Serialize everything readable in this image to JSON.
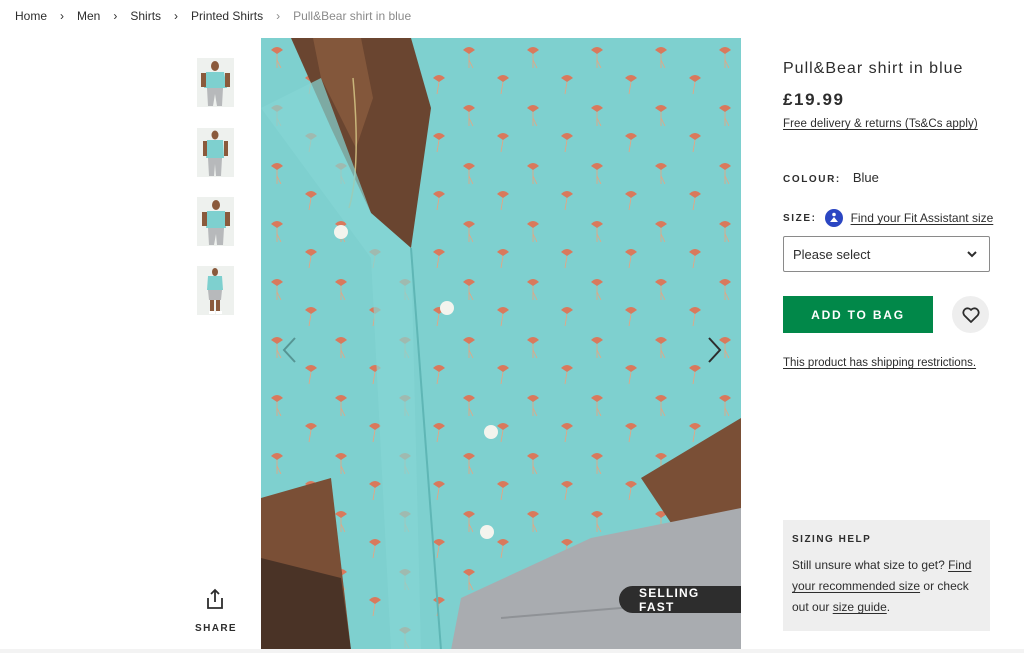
{
  "breadcrumb": {
    "items": [
      "Home",
      "Men",
      "Shirts",
      "Printed Shirts"
    ],
    "current": "Pull&Bear shirt in blue",
    "separator": "›"
  },
  "gallery": {
    "thumbnails": [
      "thumbnail-front",
      "thumbnail-side",
      "thumbnail-angle",
      "thumbnail-full"
    ],
    "badge": "SELLING FAST",
    "share_label": "SHARE",
    "icons": {
      "prev": "chevron-left-icon",
      "next": "chevron-right-icon",
      "share": "share-icon"
    }
  },
  "product": {
    "title": "Pull&Bear shirt in blue",
    "price": "£19.99",
    "delivery_link": "Free delivery & returns (Ts&Cs apply)",
    "colour_label": "COLOUR:",
    "colour_value": "Blue",
    "size_label": "SIZE:",
    "fit_link": "Find your Fit Assistant size",
    "size_placeholder": "Please select",
    "add_to_bag": "ADD TO BAG",
    "shipping_note": "This product has shipping restrictions."
  },
  "sizing_help": {
    "heading": "SIZING HELP",
    "text_1": "Still unsure what size to get? ",
    "link_1": "Find your recommended size",
    "text_2": " or check out our ",
    "link_2": "size guide",
    "text_3": "."
  },
  "colors": {
    "add_button": "#018849",
    "shirt": "#7ed0cf",
    "text": "#2d2d2d",
    "fit_badge": "#2b46c2"
  }
}
